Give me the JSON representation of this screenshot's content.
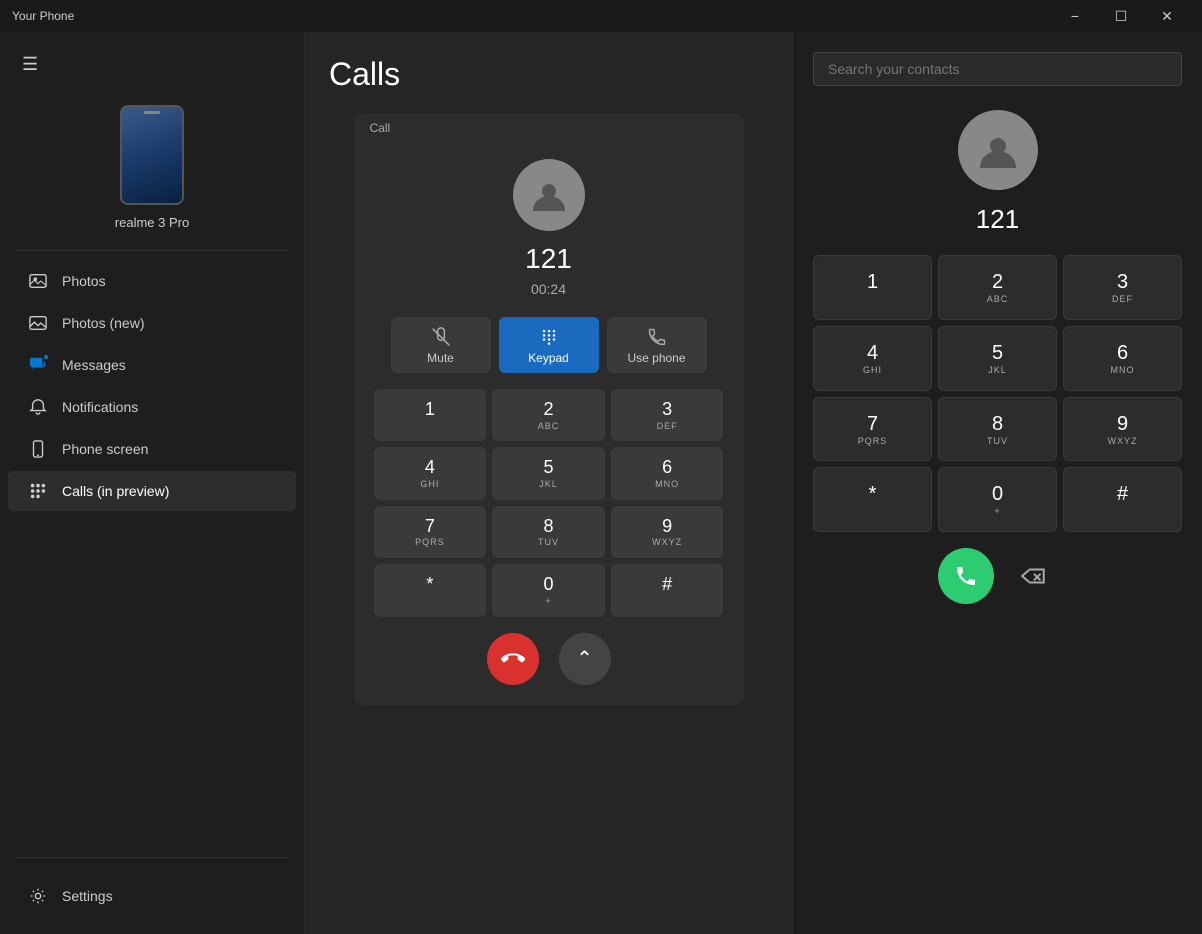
{
  "titlebar": {
    "app_name": "Your Phone",
    "minimize_label": "−",
    "maximize_label": "☐",
    "close_label": "✕"
  },
  "sidebar": {
    "hamburger_icon": "☰",
    "device_name": "realme 3 Pro",
    "nav_items": [
      {
        "id": "photos",
        "label": "Photos",
        "icon": "photos"
      },
      {
        "id": "photos-new",
        "label": "Photos (new)",
        "icon": "photos-new"
      },
      {
        "id": "messages",
        "label": "Messages",
        "icon": "messages"
      },
      {
        "id": "notifications",
        "label": "Notifications",
        "icon": "notifications"
      },
      {
        "id": "phone-screen",
        "label": "Phone screen",
        "icon": "phone-screen"
      },
      {
        "id": "calls",
        "label": "Calls (in preview)",
        "icon": "calls",
        "active": true
      }
    ],
    "settings_label": "Settings"
  },
  "calls_panel": {
    "title": "Calls",
    "call_label": "Call",
    "avatar_alt": "contact avatar",
    "number": "121",
    "timer": "00:24",
    "actions": [
      {
        "id": "mute",
        "label": "Mute"
      },
      {
        "id": "keypad",
        "label": "Keypad",
        "active": true
      },
      {
        "id": "use-phone",
        "label": "Use phone"
      }
    ],
    "keypad": [
      {
        "num": "1",
        "sub": ""
      },
      {
        "num": "2",
        "sub": "ABC"
      },
      {
        "num": "3",
        "sub": "DEF"
      },
      {
        "num": "4",
        "sub": "GHI"
      },
      {
        "num": "5",
        "sub": "JKL"
      },
      {
        "num": "6",
        "sub": "MNO"
      },
      {
        "num": "7",
        "sub": "PQRS"
      },
      {
        "num": "8",
        "sub": "TUV"
      },
      {
        "num": "9",
        "sub": "WXYZ"
      },
      {
        "num": "*",
        "sub": ""
      },
      {
        "num": "0",
        "sub": "+"
      },
      {
        "num": "#",
        "sub": ""
      }
    ]
  },
  "right_panel": {
    "search_placeholder": "Search your contacts",
    "number": "121",
    "keypad": [
      {
        "num": "1",
        "sub": ""
      },
      {
        "num": "2",
        "sub": "ABC"
      },
      {
        "num": "3",
        "sub": "DEF"
      },
      {
        "num": "4",
        "sub": "GHI"
      },
      {
        "num": "5",
        "sub": "JKL"
      },
      {
        "num": "6",
        "sub": "MNO"
      },
      {
        "num": "7",
        "sub": "PQRS"
      },
      {
        "num": "8",
        "sub": "TUV"
      },
      {
        "num": "9",
        "sub": "WXYZ"
      },
      {
        "num": "*",
        "sub": ""
      },
      {
        "num": "0",
        "sub": "+"
      },
      {
        "num": "#",
        "sub": ""
      }
    ]
  }
}
